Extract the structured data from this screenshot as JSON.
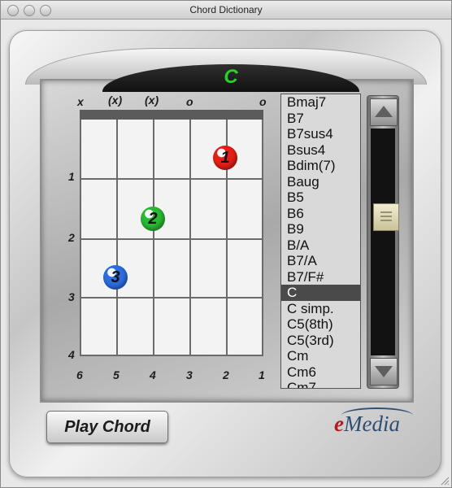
{
  "window": {
    "title": "Chord Dictionary"
  },
  "chord": {
    "name": "C"
  },
  "strings": {
    "markers": [
      "x",
      "(x)",
      "(x)",
      "o",
      "",
      "o"
    ],
    "numbers": [
      "6",
      "5",
      "4",
      "3",
      "2",
      "1"
    ]
  },
  "frets": {
    "numbers": [
      "1",
      "2",
      "3",
      "4"
    ]
  },
  "fingers": [
    {
      "label": "1",
      "color": "#e41f17"
    },
    {
      "label": "2",
      "color": "#29b933"
    },
    {
      "label": "3",
      "color": "#2d6de0"
    }
  ],
  "chord_list": {
    "items": [
      "Bmaj7",
      "B7",
      "B7sus4",
      "Bsus4",
      "Bdim(7)",
      "Baug",
      "B5",
      "B6",
      "B9",
      "B/A",
      "B7/A",
      "B7/F#",
      "C",
      "C simp.",
      "C5(8th)",
      "C5(3rd)",
      "Cm",
      "Cm6",
      "Cm7"
    ],
    "selected": "C"
  },
  "buttons": {
    "play_chord": "Play Chord"
  },
  "logo": {
    "e": "e",
    "rest": "Media"
  }
}
